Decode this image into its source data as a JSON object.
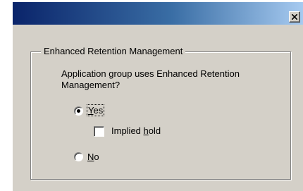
{
  "window": {
    "title": "",
    "close_glyph": "close-icon"
  },
  "group": {
    "legend": "Enhanced Retention Management",
    "question": "Application group uses Enhanced Retention Management?"
  },
  "options": {
    "yes": {
      "label_prefix": "",
      "label_mnemonic": "Y",
      "label_rest": "es",
      "selected": true
    },
    "implied_hold": {
      "label_prefix": "Implied ",
      "label_mnemonic": "h",
      "label_rest": "old",
      "checked": false
    },
    "no": {
      "label_prefix": "",
      "label_mnemonic": "N",
      "label_rest": "o",
      "selected": false
    }
  },
  "colors": {
    "face": "#d4d0c8",
    "title_start": "#0a246a",
    "title_end": "#a6caf0"
  }
}
